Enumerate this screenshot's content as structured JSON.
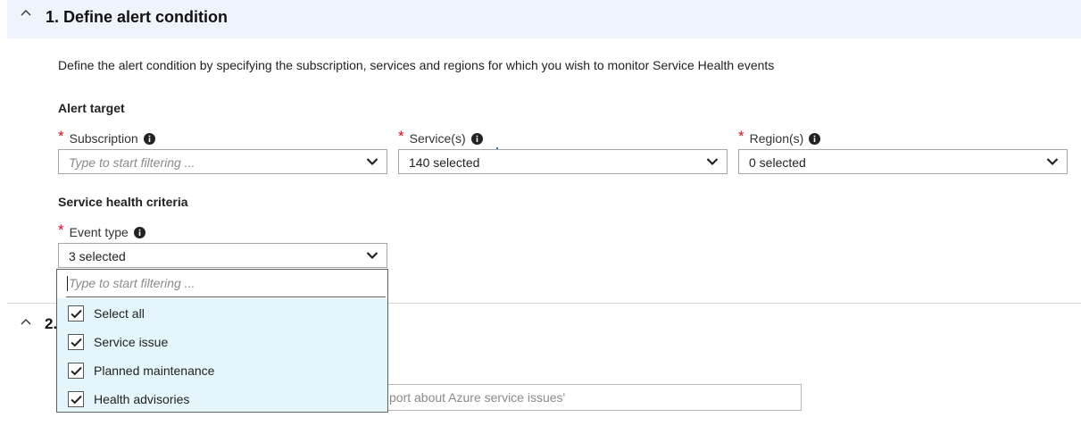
{
  "section1": {
    "title": "1. Define alert condition",
    "description": "Define the alert condition by specifying the subscription, services and regions for which you wish to monitor Service Health events",
    "alert_target_heading": "Alert target",
    "subscription": {
      "label": "Subscription",
      "placeholder": "Type to start filtering ..."
    },
    "services": {
      "label": "Service(s)",
      "value": "140 selected"
    },
    "regions": {
      "label": "Region(s)",
      "value": "0 selected"
    },
    "criteria_heading": "Service health criteria",
    "event_type": {
      "label": "Event type",
      "value": "3 selected",
      "filter_placeholder": "Type to start filtering ...",
      "options": [
        {
          "label": "Select all",
          "checked": true
        },
        {
          "label": "Service issue",
          "checked": true
        },
        {
          "label": "Planned maintenance",
          "checked": true
        },
        {
          "label": "Health advisories",
          "checked": true
        }
      ]
    }
  },
  "section2": {
    "title_fragment": "2.",
    "input_partial_placeholder": "port about Azure service issues'"
  },
  "colors": {
    "header_bg": "#eef4fc",
    "required_star": "#e00b1c",
    "list_bg": "#e5f5fc"
  },
  "icons": {
    "collapse": "chevron-up-icon",
    "info": "info-icon",
    "dropdown": "chevron-down-icon",
    "check": "checkmark-icon"
  }
}
